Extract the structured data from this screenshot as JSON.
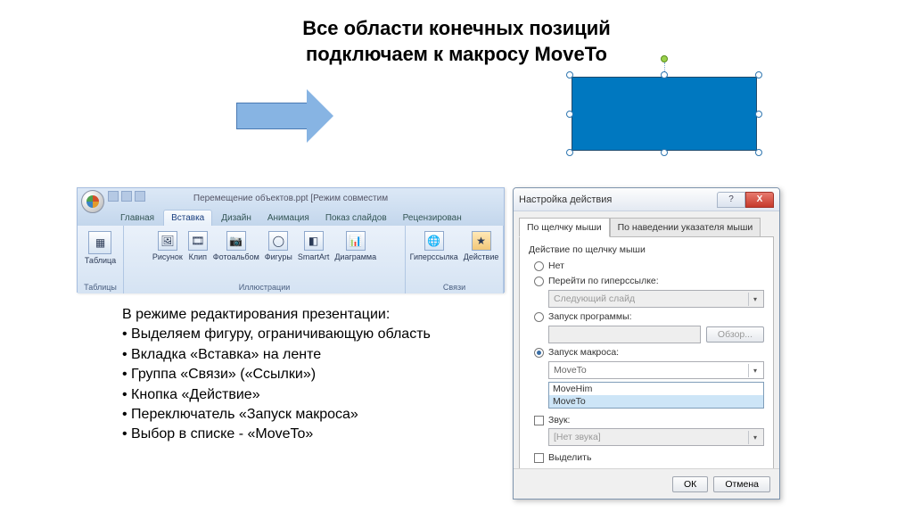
{
  "title_line1": "Все области конечных позиций",
  "title_line2": "подключаем к макросу MoveTo",
  "ribbon": {
    "doc_title": "Перемещение объектов.ppt [Режим совместим",
    "tabs": [
      "Главная",
      "Вставка",
      "Дизайн",
      "Анимация",
      "Показ слайдов",
      "Рецензирован"
    ],
    "active_tab_index": 1,
    "group_tables": {
      "label": "Таблицы",
      "btn": "Таблица"
    },
    "group_illustrations": {
      "label": "Иллюстрации",
      "btns": [
        "Рисунок",
        "Клип",
        "Фотоальбом",
        "Фигуры",
        "SmartArt",
        "Диаграмма"
      ]
    },
    "group_links": {
      "label": "Связи",
      "btns": [
        "Гиперссылка",
        "Действие"
      ]
    }
  },
  "instructions": {
    "intro": "В режиме редактирования презентации:",
    "items": [
      "Выделяем фигуру, ограничивающую область",
      "Вкладка «Вставка» на ленте",
      "Группа «Связи» («Ссылки»)",
      "Кнопка «Действие»",
      "Переключатель «Запуск макроса»",
      "Выбор в списке - «MoveTo»"
    ]
  },
  "dialog": {
    "title": "Настройка действия",
    "tab1": "По щелчку мыши",
    "tab2": "По наведении указателя мыши",
    "group_label": "Действие по щелчку мыши",
    "opt_none": "Нет",
    "opt_hyperlink": "Перейти по гиперссылке:",
    "hyperlink_value": "Следующий слайд",
    "opt_program": "Запуск программы:",
    "browse": "Обзор...",
    "opt_macro": "Запуск макроса:",
    "macro_selected": "MoveTo",
    "macro_list": [
      "MoveHim",
      "MoveTo"
    ],
    "chk_sound": "Звук:",
    "sound_value": "[Нет звука]",
    "chk_highlight": "Выделить",
    "btn_ok": "ОК",
    "btn_cancel": "Отмена"
  }
}
